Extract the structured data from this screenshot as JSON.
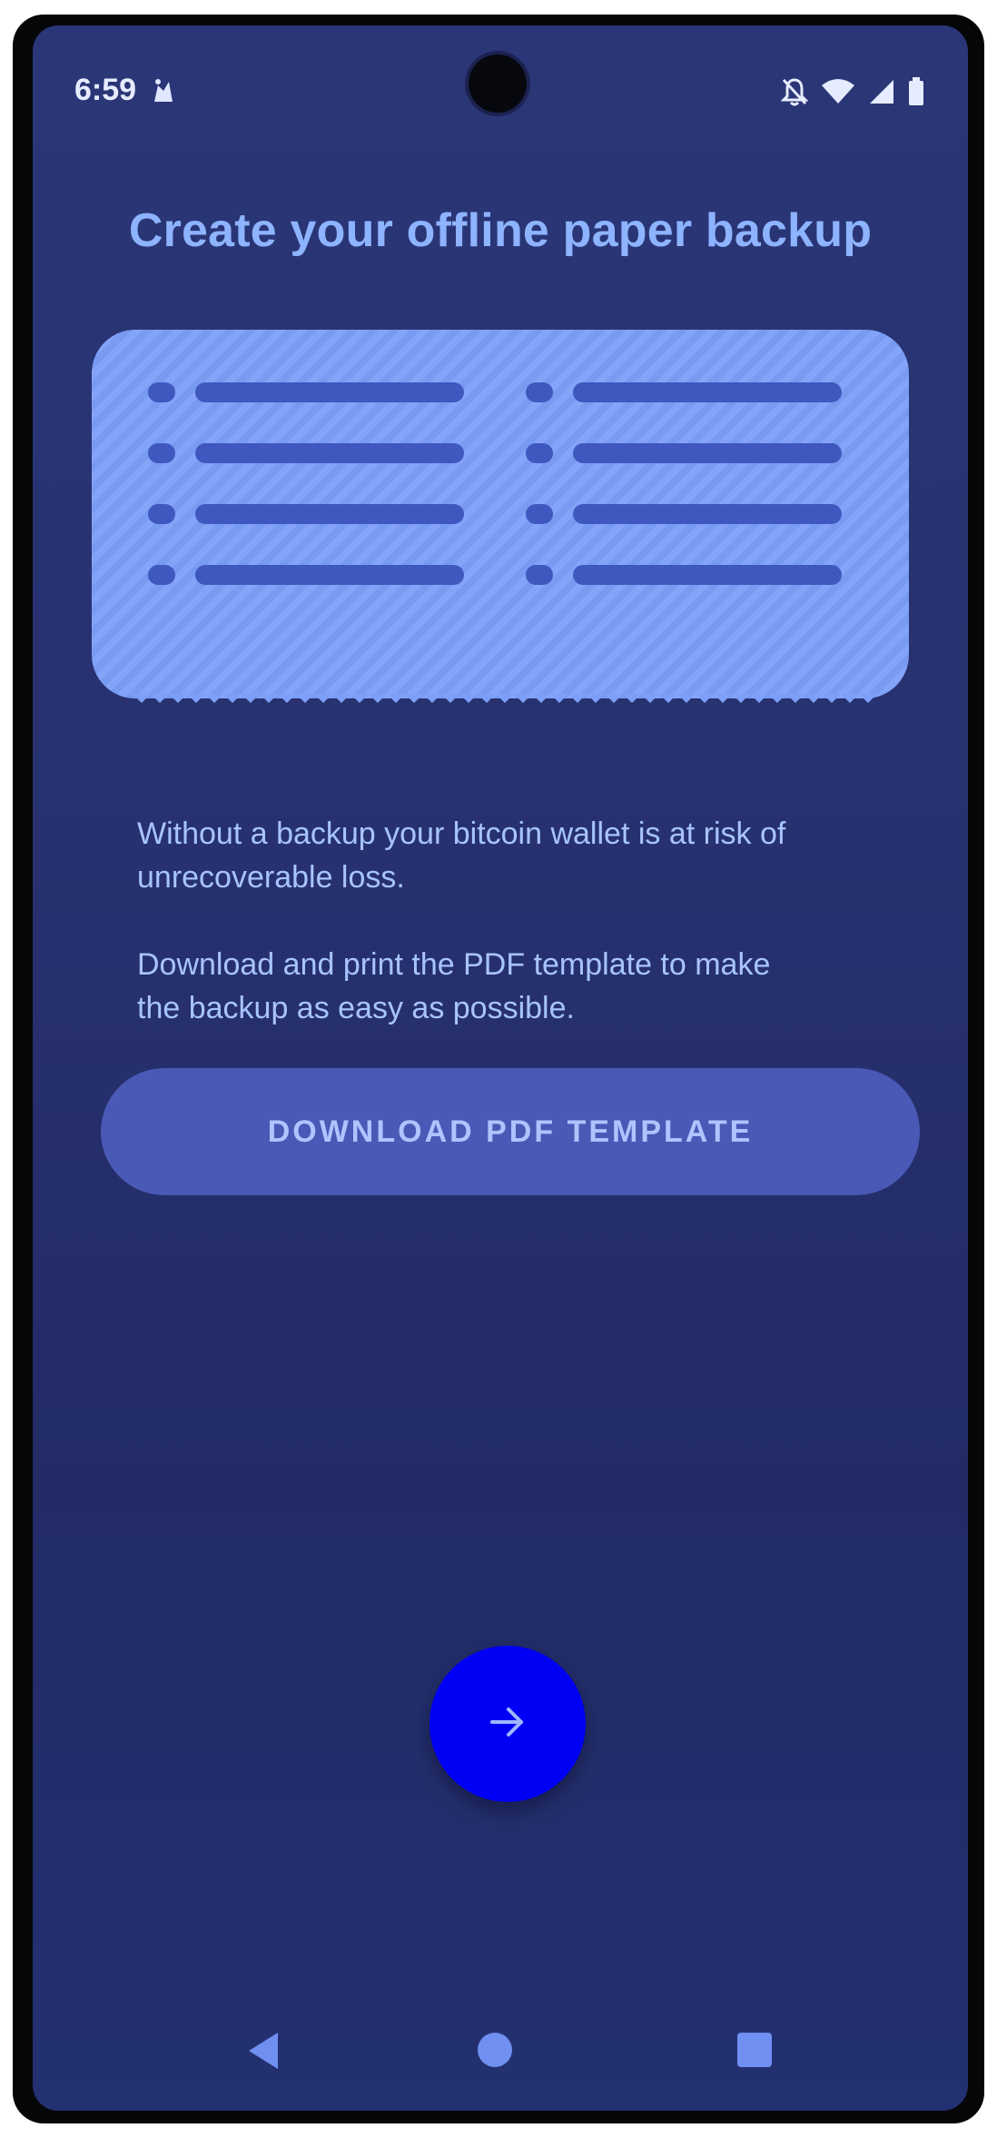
{
  "status_bar": {
    "time": "6:59",
    "app_icon": "android-notification-icon",
    "icons": [
      "bell-off-icon",
      "wifi-icon",
      "cellular-signal-icon",
      "battery-icon"
    ]
  },
  "title": "Create your offline paper backup",
  "illustration": {
    "icon": "paper-backup-illustration",
    "columns": 2,
    "rows_per_column": 4
  },
  "description": {
    "paragraph_1": "Without a backup your bitcoin wallet is at risk of unrecoverable loss.",
    "paragraph_2": "Download and print the PDF template to make the backup as easy as possible."
  },
  "download_button": {
    "label": "DOWNLOAD PDF TEMPLATE"
  },
  "next_button": {
    "icon": "arrow-right-icon"
  },
  "nav_bar": {
    "icons": [
      "back-icon",
      "home-icon",
      "recents-icon"
    ]
  },
  "colors": {
    "background": "#27316f",
    "title": "#8eb3ff",
    "paper": "#7c9ff8",
    "paper_lines": "#3f58c0",
    "button": "#4959b5",
    "fab": "#0000f4"
  }
}
